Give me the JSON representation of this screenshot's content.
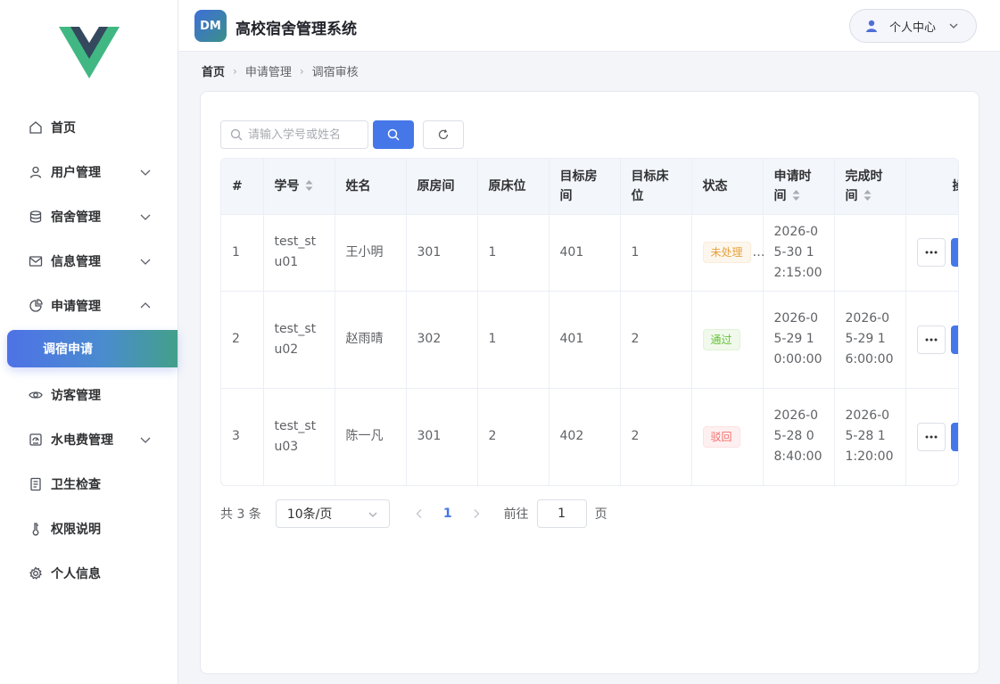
{
  "app": {
    "badge": "DM",
    "title": "高校宿舍管理系统"
  },
  "user_menu": {
    "label": "个人中心"
  },
  "sidebar": {
    "items": [
      {
        "label": "首页",
        "icon": "home-icon"
      },
      {
        "label": "用户管理",
        "icon": "user-icon",
        "expandable": true
      },
      {
        "label": "宿舍管理",
        "icon": "database-icon",
        "expandable": true
      },
      {
        "label": "信息管理",
        "icon": "mail-icon",
        "expandable": true
      },
      {
        "label": "申请管理",
        "icon": "pie-chart-icon",
        "expandable": true,
        "expanded": true
      },
      {
        "label": "访客管理",
        "icon": "eye-icon"
      },
      {
        "label": "水电费管理",
        "icon": "meter-icon",
        "expandable": true
      },
      {
        "label": "卫生检查",
        "icon": "document-icon"
      },
      {
        "label": "权限说明",
        "icon": "thermometer-icon"
      },
      {
        "label": "个人信息",
        "icon": "gear-icon"
      }
    ],
    "active_sub": "调宿申请"
  },
  "breadcrumb": [
    "首页",
    "申请管理",
    "调宿审核"
  ],
  "search": {
    "placeholder": "请输入学号或姓名",
    "value": ""
  },
  "table": {
    "columns": [
      "#",
      "学号",
      "姓名",
      "原房间",
      "原床位",
      "目标房间",
      "目标床位",
      "状态",
      "申请时间",
      "完成时间",
      "操作"
    ],
    "rows": [
      {
        "index": "1",
        "student_id": "test_stu01",
        "name": "王小明",
        "from_room": "301",
        "from_bed": "1",
        "to_room": "401",
        "to_bed": "1",
        "status": "未处理",
        "status_type": "warning",
        "apply_time": "2026-05-30 12:15:00",
        "finish_time": ""
      },
      {
        "index": "2",
        "student_id": "test_stu02",
        "name": "赵雨晴",
        "from_room": "302",
        "from_bed": "1",
        "to_room": "401",
        "to_bed": "2",
        "status": "通过",
        "status_type": "success",
        "apply_time": "2026-05-29 10:00:00",
        "finish_time": "2026-05-29 16:00:00"
      },
      {
        "index": "3",
        "student_id": "test_stu03",
        "name": "陈一凡",
        "from_room": "301",
        "from_bed": "2",
        "to_room": "402",
        "to_bed": "2",
        "status": "驳回",
        "status_type": "danger",
        "apply_time": "2026-05-28 08:40:00",
        "finish_time": "2026-05-28 11:20:00"
      }
    ]
  },
  "pagination": {
    "total": "共 3 条",
    "page_size": "10条/页",
    "current": "1",
    "goto_label": "前往",
    "goto_value": "1",
    "page_suffix": "页"
  },
  "colors": {
    "primary": "#4677e8",
    "gradient_end": "#43a08a",
    "warning": "#e6a23c",
    "success": "#67c23a",
    "danger": "#f56c6c"
  }
}
